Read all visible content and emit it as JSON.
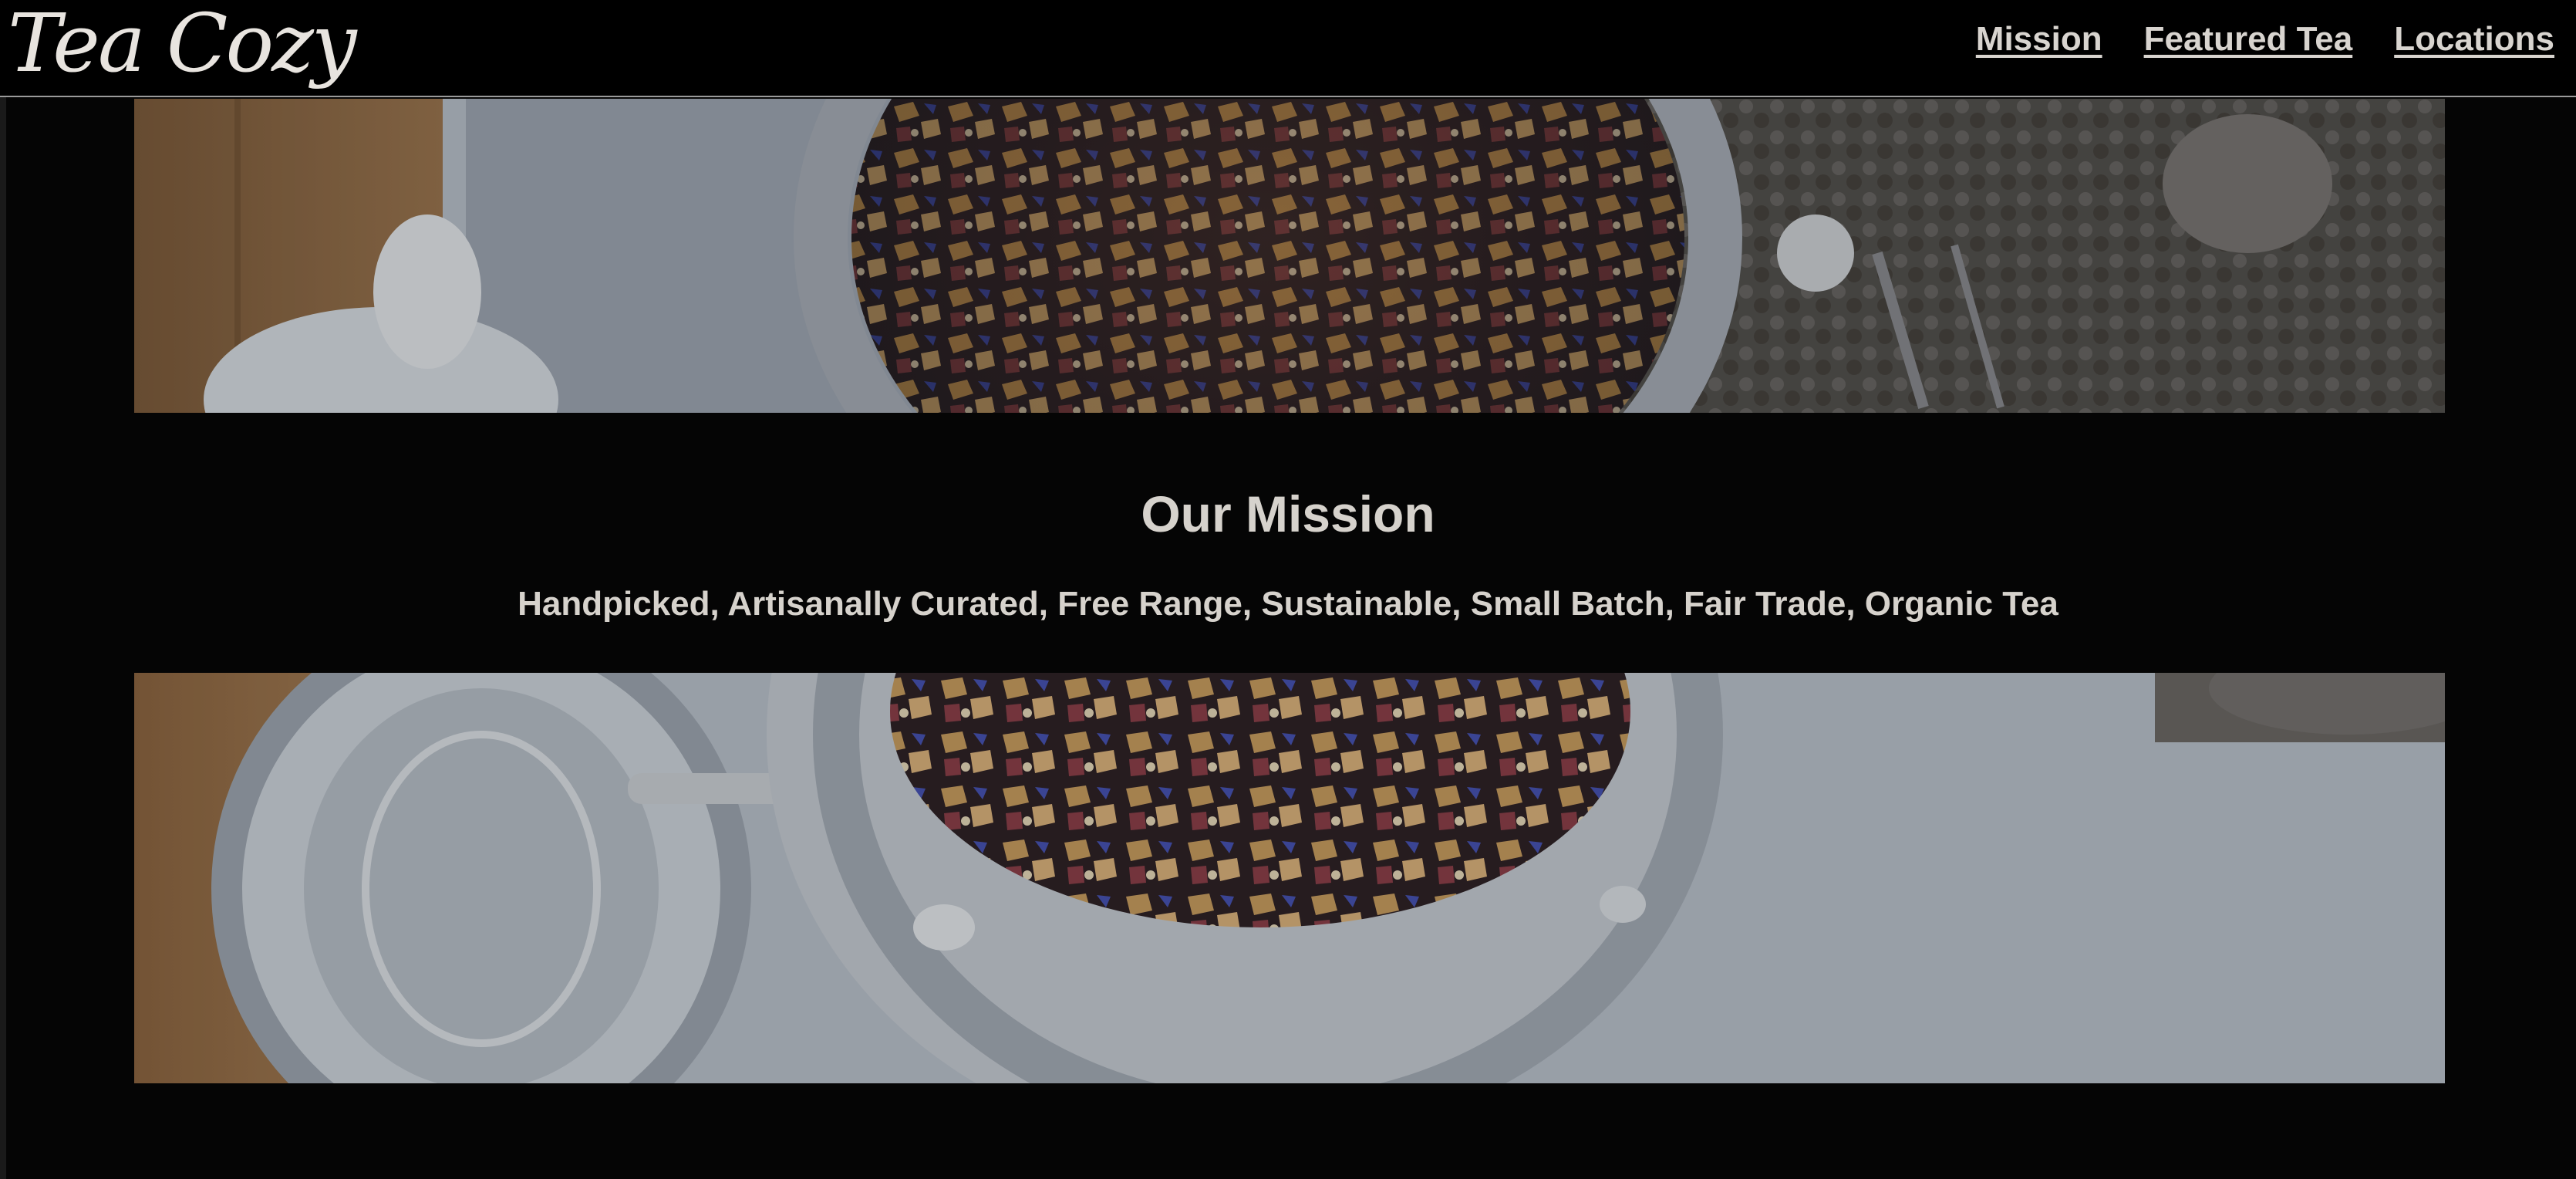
{
  "header": {
    "logo_text": "Tea Cozy",
    "nav": [
      {
        "label": "Mission"
      },
      {
        "label": "Featured Tea"
      },
      {
        "label": "Locations"
      }
    ]
  },
  "mission": {
    "title": "Our Mission",
    "subtitle": "Handpicked, Artisanally Curated, Free Range, Sustainable, Small Batch, Fair Trade, Organic Tea"
  },
  "images": {
    "top": "tea-jar-top-photo",
    "bottom": "tea-jar-bottom-photo"
  },
  "colors": {
    "background": "#050505",
    "text": "#d6d2cc",
    "header_border": "#9a9a9a"
  }
}
